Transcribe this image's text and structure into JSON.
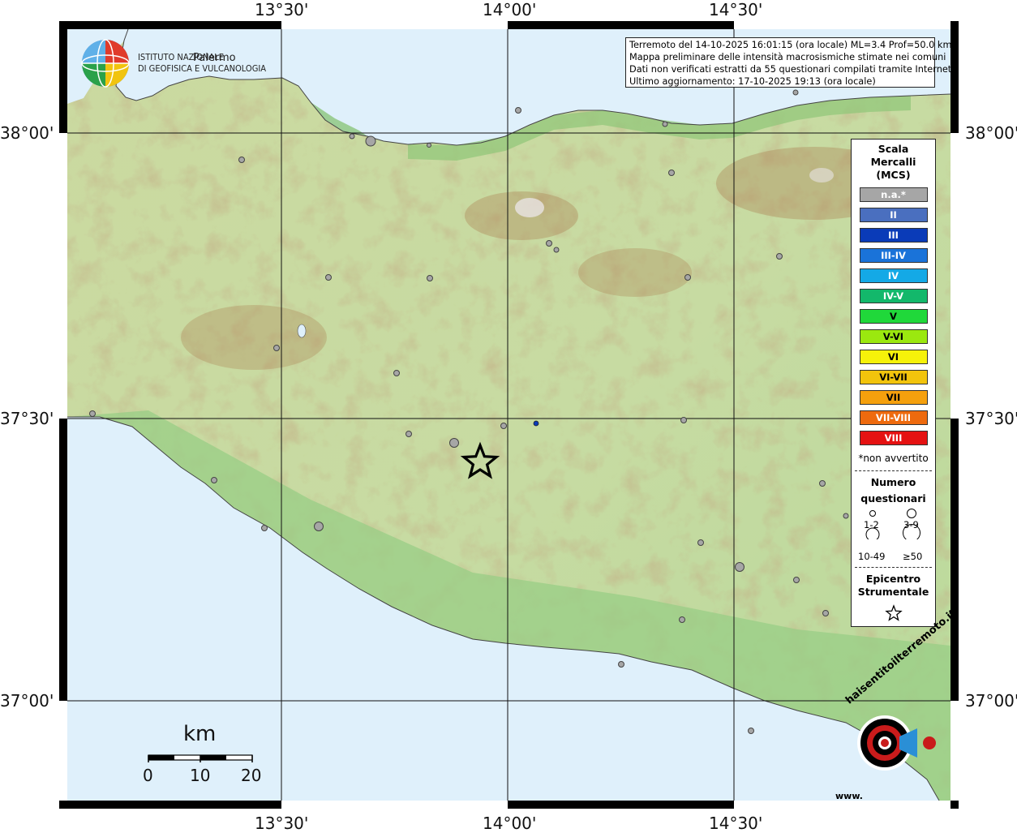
{
  "info": {
    "line1": "Terremoto del 14-10-2025 16:01:15 (ora locale) ML=3.4 Prof=50.0 km",
    "line2": "Mappa preliminare delle intensità macrosismiche stimate nei comuni",
    "line3": "Dati non verificati estratti da 55 questionari compilati tramite Internet.",
    "line4": "Ultimo aggiornamento: 17-10-2025 19:13 (ora locale)"
  },
  "institute": {
    "line1": "ISTITUTO NAZIONALE",
    "line2": "DI GEOFISICA E VULCANOLOGIA"
  },
  "place_label": "Palermo",
  "axes": {
    "top": [
      "13°30'",
      "14°00'",
      "14°30'"
    ],
    "bottom": [
      "13°30'",
      "14°00'",
      "14°30'"
    ],
    "left": [
      "38°00'",
      "37°30'",
      "37°00'"
    ],
    "right": [
      "38°00'",
      "37°30'",
      "37°00'"
    ]
  },
  "legend": {
    "title_lines": [
      "Scala",
      "Mercalli",
      "(MCS)"
    ],
    "classes": [
      {
        "label": "n.a.*",
        "color": "#a6a6a6"
      },
      {
        "label": "II",
        "color": "#4a6fbf"
      },
      {
        "label": "III",
        "color": "#0a3bb8"
      },
      {
        "label": "III-IV",
        "color": "#1a73d9"
      },
      {
        "label": "IV",
        "color": "#14a9e6"
      },
      {
        "label": "IV-V",
        "color": "#13b86b"
      },
      {
        "label": "V",
        "color": "#20d83a"
      },
      {
        "label": "V-VI",
        "color": "#9be80f"
      },
      {
        "label": "VI",
        "color": "#f6f20a"
      },
      {
        "label": "VI-VII",
        "color": "#f2c40c"
      },
      {
        "label": "VII",
        "color": "#f5a00d"
      },
      {
        "label": "VII-VIII",
        "color": "#ee6a0e"
      },
      {
        "label": "VIII",
        "color": "#e51212"
      }
    ],
    "note": "*non avvertito",
    "count_title": [
      "Numero",
      "questionari"
    ],
    "count_labels": [
      "1-2",
      "3-9",
      "10-49",
      "≥50"
    ],
    "epicenter_title": [
      "Epicentro",
      "Strumentale"
    ]
  },
  "scale_bar": {
    "unit": "km",
    "ticks": [
      "0",
      "10",
      "20"
    ]
  },
  "brand": {
    "text": "haisentitoilterremoto.it",
    "url": "www."
  }
}
